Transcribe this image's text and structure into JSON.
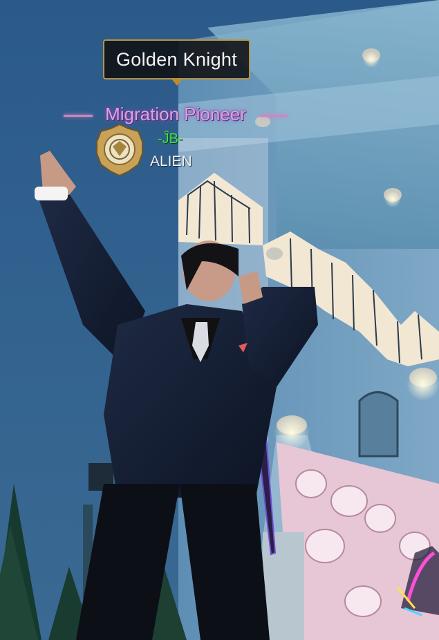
{
  "tooltip": {
    "text": "Golden Knight"
  },
  "nameplate": {
    "title": "Migration Pioneer",
    "guild_tag": "-ĴB-",
    "player_name": "ALIEN",
    "colors": {
      "title": "#d9a7d0",
      "guild_tag": "#3fe24a",
      "player_name": "#f1f1f1"
    }
  },
  "icons": {
    "emblem": "golden-knight-badge-icon"
  }
}
